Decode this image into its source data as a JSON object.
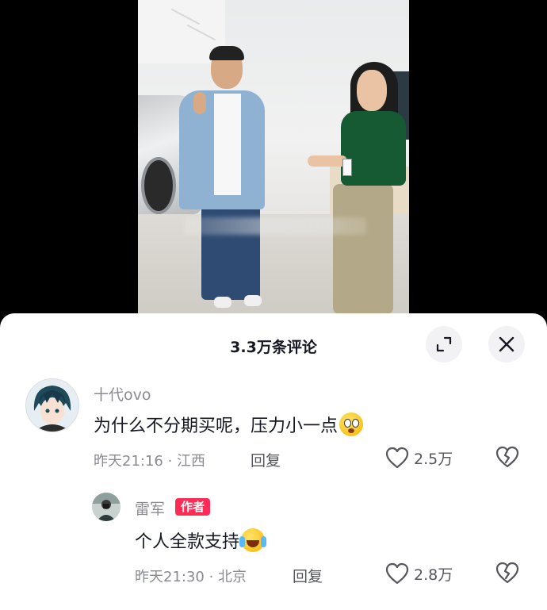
{
  "video": {
    "subtitle_obscured": true
  },
  "sheet": {
    "title": "3.3万条评论",
    "expand_icon": "expand-icon",
    "close_icon": "close-icon"
  },
  "comments": [
    {
      "username": "十代ovo",
      "text": "为什么不分期买呢，压力小一点",
      "emoji": "flushed-face",
      "time": "昨天21:16",
      "location": "江西",
      "reply_label": "回复",
      "likes": "2.5万"
    },
    {
      "username": "雷军",
      "badge": "作者",
      "text": "个人全款支持",
      "emoji": "rolling-on-floor-laughing",
      "time": "昨天21:30",
      "location": "北京",
      "reply_label": "回复",
      "likes": "2.8万"
    }
  ],
  "separator": " · ",
  "colors": {
    "author_badge": "#fe2c55",
    "text_primary": "#161823",
    "text_secondary": "#8a8b91"
  }
}
